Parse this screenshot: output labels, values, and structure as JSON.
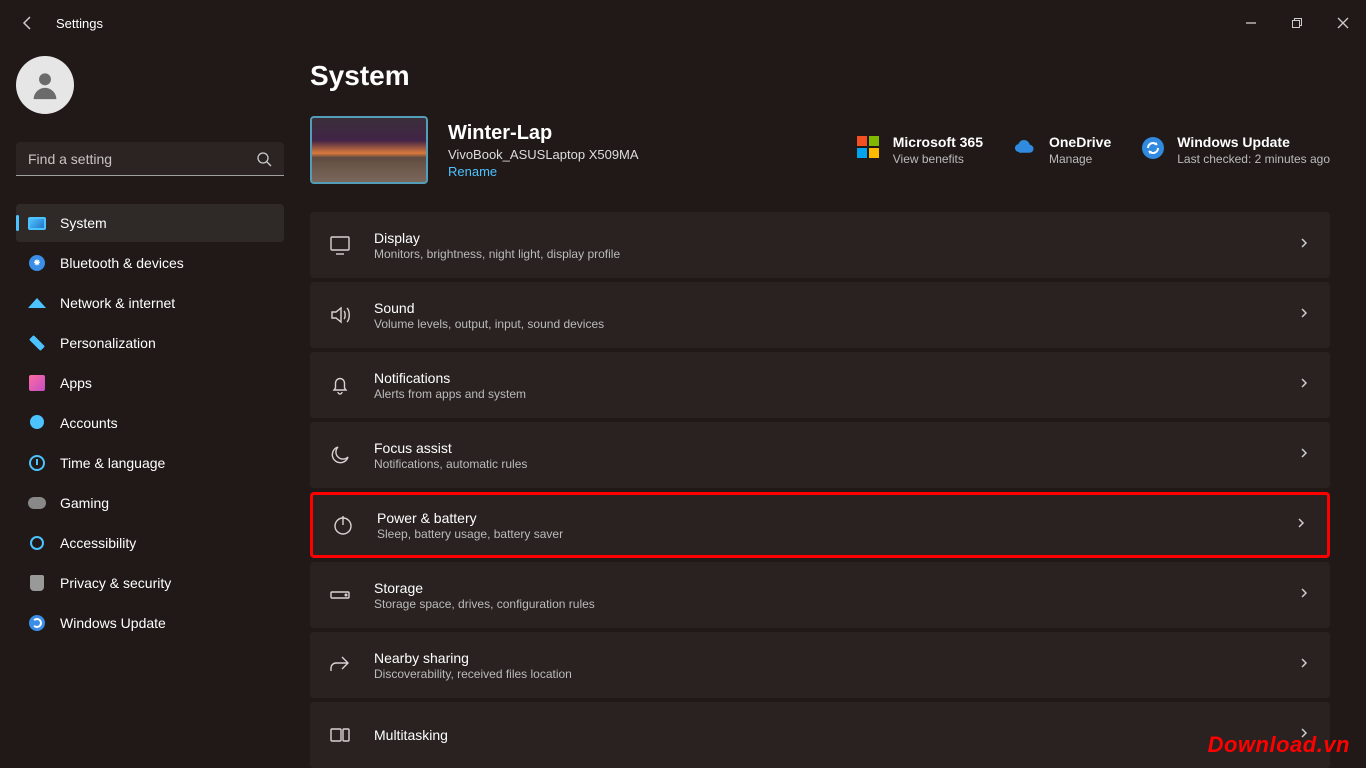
{
  "app_title": "Settings",
  "search_placeholder": "Find a setting",
  "page_title": "System",
  "device": {
    "name": "Winter-Lap",
    "model": "VivoBook_ASUSLaptop X509MA",
    "rename": "Rename"
  },
  "services": [
    {
      "title": "Microsoft 365",
      "sub": "View benefits"
    },
    {
      "title": "OneDrive",
      "sub": "Manage"
    },
    {
      "title": "Windows Update",
      "sub": "Last checked: 2 minutes ago"
    }
  ],
  "nav": [
    {
      "label": "System"
    },
    {
      "label": "Bluetooth & devices"
    },
    {
      "label": "Network & internet"
    },
    {
      "label": "Personalization"
    },
    {
      "label": "Apps"
    },
    {
      "label": "Accounts"
    },
    {
      "label": "Time & language"
    },
    {
      "label": "Gaming"
    },
    {
      "label": "Accessibility"
    },
    {
      "label": "Privacy & security"
    },
    {
      "label": "Windows Update"
    }
  ],
  "settings": [
    {
      "title": "Display",
      "sub": "Monitors, brightness, night light, display profile"
    },
    {
      "title": "Sound",
      "sub": "Volume levels, output, input, sound devices"
    },
    {
      "title": "Notifications",
      "sub": "Alerts from apps and system"
    },
    {
      "title": "Focus assist",
      "sub": "Notifications, automatic rules"
    },
    {
      "title": "Power & battery",
      "sub": "Sleep, battery usage, battery saver"
    },
    {
      "title": "Storage",
      "sub": "Storage space, drives, configuration rules"
    },
    {
      "title": "Nearby sharing",
      "sub": "Discoverability, received files location"
    },
    {
      "title": "Multitasking",
      "sub": ""
    }
  ],
  "watermark": "Download.vn"
}
